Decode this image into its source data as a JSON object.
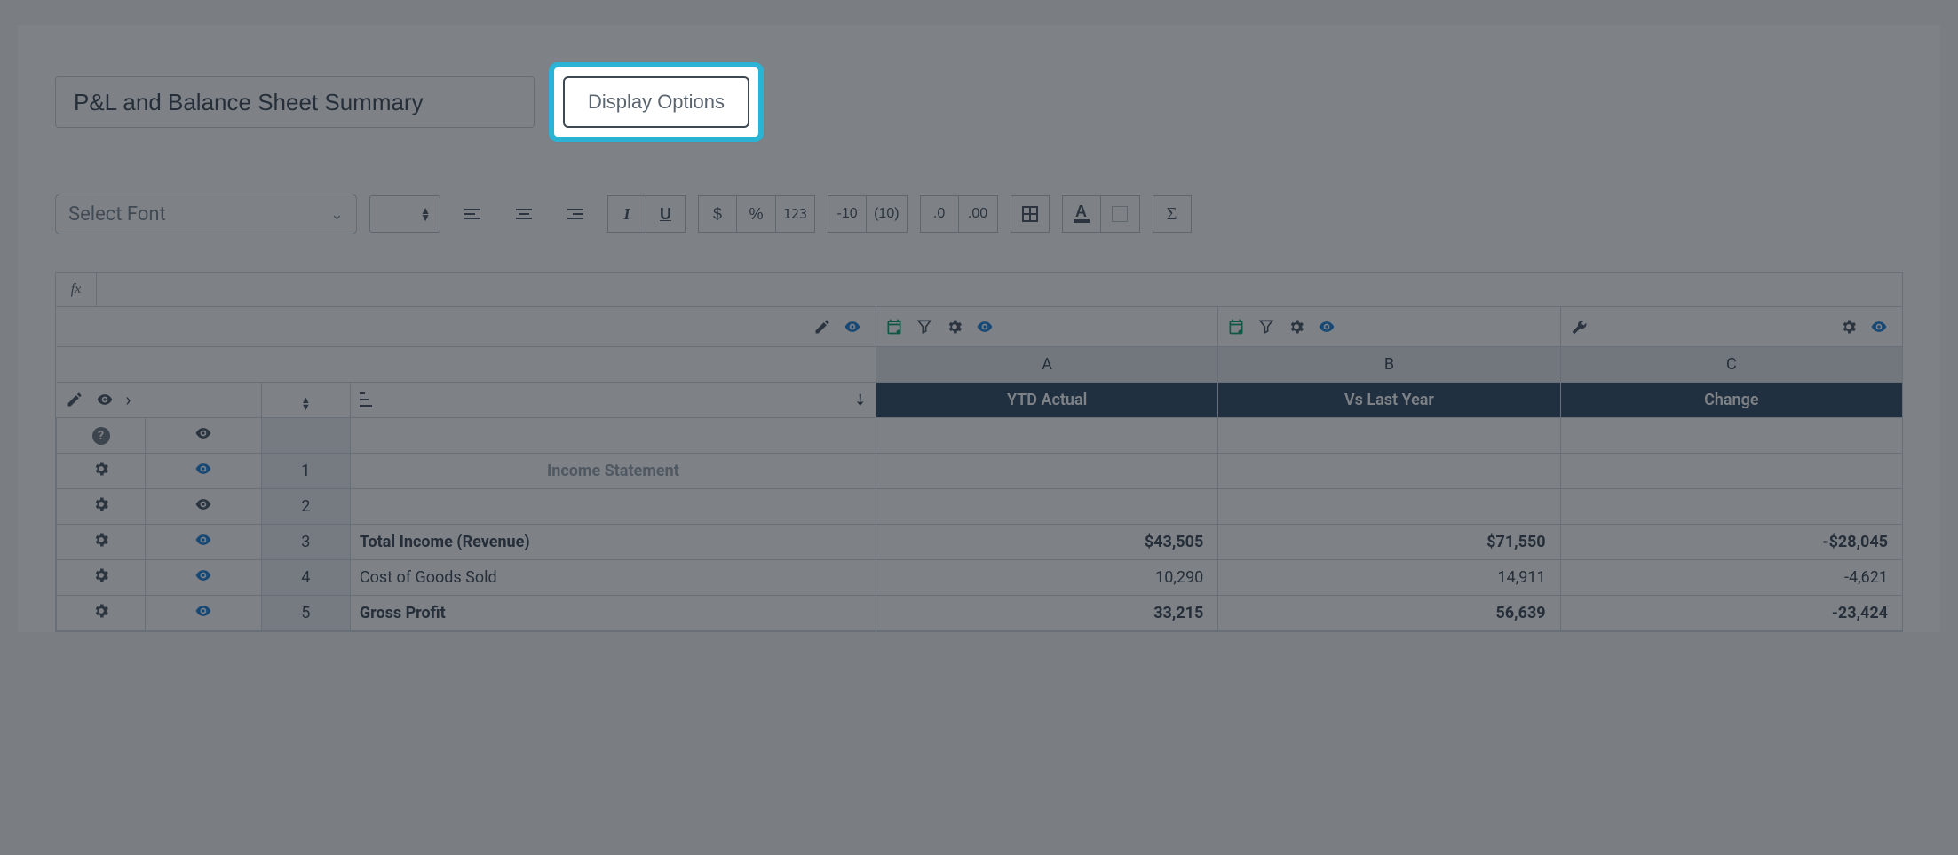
{
  "header": {
    "title": "P&L and Balance Sheet Summary",
    "display_options_label": "Display Options"
  },
  "toolbar": {
    "font_placeholder": "Select Font",
    "neg_a": "-10",
    "neg_b": "(10)",
    "dec_less": ".0",
    "dec_more": ".00",
    "num_123": "123"
  },
  "formula": {
    "fx": "fx",
    "value": ""
  },
  "grid": {
    "col_letters": [
      "A",
      "B",
      "C"
    ],
    "col_headers": [
      "YTD Actual",
      "Vs Last Year",
      "Change"
    ],
    "rows": [
      {
        "num": "",
        "label": "",
        "a": "",
        "b": "",
        "c": "",
        "kind": "blank-q"
      },
      {
        "num": "1",
        "label": "Income Statement",
        "a": "",
        "b": "",
        "c": "",
        "kind": "section"
      },
      {
        "num": "2",
        "label": "",
        "a": "",
        "b": "",
        "c": "",
        "kind": "blank"
      },
      {
        "num": "3",
        "label": "Total Income (Revenue)",
        "a": "$43,505",
        "b": "$71,550",
        "c": "-$28,045",
        "kind": "bold"
      },
      {
        "num": "4",
        "label": "Cost of Goods Sold",
        "a": "10,290",
        "b": "14,911",
        "c": "-4,621",
        "kind": "normal"
      },
      {
        "num": "5",
        "label": "Gross Profit",
        "a": "33,215",
        "b": "56,639",
        "c": "-23,424",
        "kind": "bold"
      }
    ]
  }
}
